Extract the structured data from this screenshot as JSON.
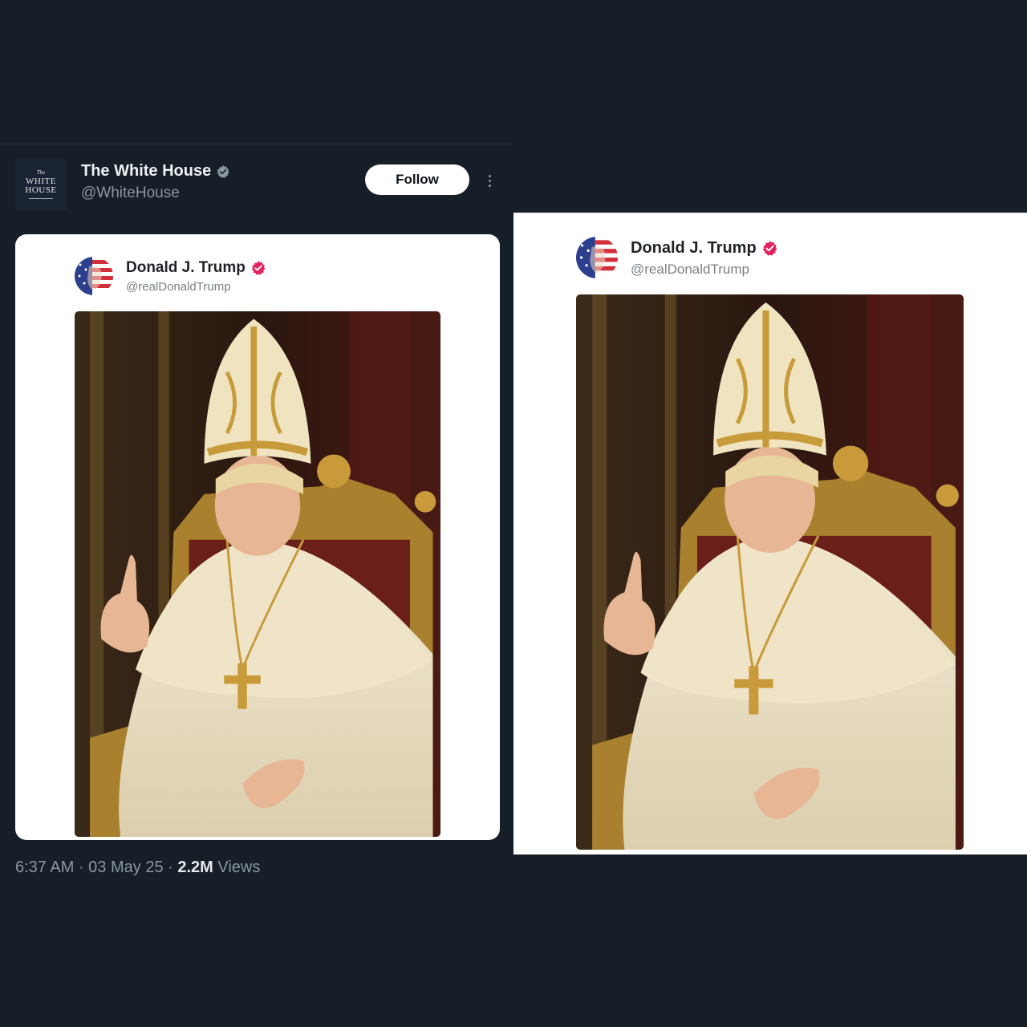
{
  "left_post": {
    "author": {
      "name": "The White House",
      "handle": "@WhiteHouse",
      "avatar_text": {
        "top": "The",
        "line1": "WHITE",
        "line2": "HOUSE"
      }
    },
    "follow_label": "Follow",
    "more_icon": "more-vertical-icon",
    "embedded": {
      "author_name": "Donald J. Trump",
      "author_handle": "@realDonaldTrump"
    },
    "meta": {
      "time": "6:37 AM",
      "sep1": " · ",
      "date": "03 May 25",
      "sep2": " · ",
      "views_count": "2.2M",
      "views_label": " Views"
    }
  },
  "right_post": {
    "author_name": "Donald J. Trump",
    "author_handle": "@realDonaldTrump"
  },
  "colors": {
    "background": "#161e27",
    "verified_gray": "#8b97a3",
    "verified_pink": "#e0245e"
  }
}
